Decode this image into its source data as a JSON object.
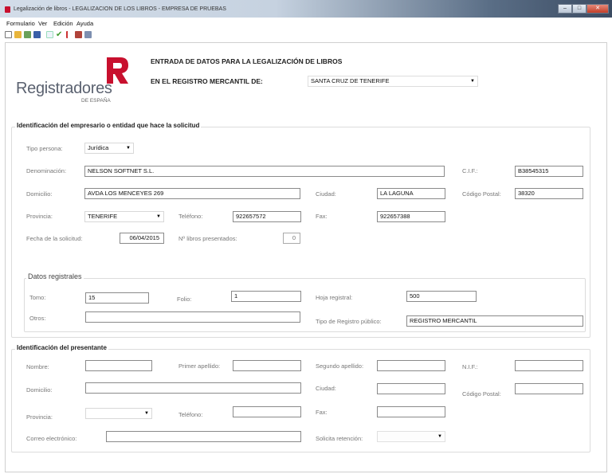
{
  "window": {
    "title": "Legalización de libros - LEGALIZACION DE LOS LIBROS - EMPRESA DE PRUEBAS",
    "minimize": "–",
    "maximize": "□",
    "close": "✕"
  },
  "menu": [
    "Formulario",
    "Ver",
    "Edición",
    "Ayuda"
  ],
  "toolbar_icons": [
    "new-icon",
    "open-icon",
    "export-icon",
    "save-icon",
    "undo-icon",
    "check-icon",
    "flag-icon",
    "book-icon",
    "print-icon"
  ],
  "logo": {
    "name": "Registradores",
    "subtitle": "DE ESPAÑA",
    "color": "#c8102e"
  },
  "header": {
    "line1": "ENTRADA DE DATOS PARA LA LEGALIZACIÓN DE LIBROS",
    "line2": "EN EL REGISTRO MERCANTIL DE:",
    "registro_value": "SANTA CRUZ DE TENERIFE"
  },
  "empresario": {
    "title": "Identificación del empresario o entidad que hace la solicitud",
    "tipo_persona_label": "Tipo persona:",
    "tipo_persona_value": "Jurídica",
    "denominacion_label": "Denominación:",
    "denominacion_value": "NELSON SOFTNET S.L.",
    "cif_label": "C.I.F.:",
    "cif_value": "B38545315",
    "domicilio_label": "Domicilio:",
    "domicilio_value": "AVDA LOS MENCEYES 269",
    "ciudad_label": "Ciudad:",
    "ciudad_value": "LA LAGUNA",
    "cp_label": "Código Postal:",
    "cp_value": "38320",
    "provincia_label": "Provincia:",
    "provincia_value": "TENERIFE",
    "telefono_label": "Teléfono:",
    "telefono_value": "922657572",
    "fax_label": "Fax:",
    "fax_value": "922657388",
    "fecha_label": "Fecha de la solicitud:",
    "fecha_value": "06/04/2015",
    "libros_label": "Nº libros presentados:",
    "libros_value": "0"
  },
  "registrales": {
    "title": "Datos registrales",
    "tomo_label": "Tomo:",
    "tomo_value": "15",
    "folio_label": "Folio:",
    "folio_value": "1",
    "hoja_label": "Hoja registral:",
    "hoja_value": "500",
    "otros_label": "Otros:",
    "otros_value": "",
    "tipo_registro_label": "Tipo de Registro público:",
    "tipo_registro_value": "REGISTRO MERCANTIL"
  },
  "presentante": {
    "title": "Identificación del presentante",
    "nombre_label": "Nombre:",
    "primer_apellido_label": "Primer apellido:",
    "segundo_apellido_label": "Segundo apellido:",
    "nif_label": "N.I.F.:",
    "domicilio_label": "Domicilio:",
    "ciudad_label": "Ciudad:",
    "cp_label": "Código Postal:",
    "provincia_label": "Provincia:",
    "telefono_label": "Teléfono:",
    "fax_label": "Fax:",
    "correo_label": "Correo electrónico:",
    "retencion_label": "Solicita retención:"
  }
}
